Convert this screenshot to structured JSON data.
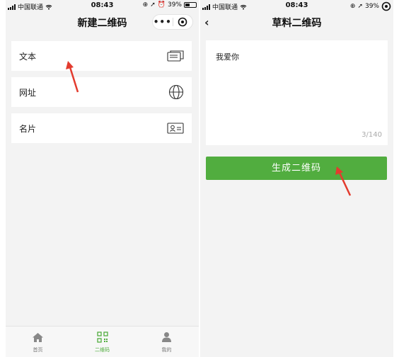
{
  "left": {
    "status": {
      "carrier": "中国联通",
      "time": "08:43",
      "battery": "39%"
    },
    "nav": {
      "title": "新建二维码",
      "more": "•••"
    },
    "items": [
      {
        "label": "文本",
        "icon": "text-card-icon"
      },
      {
        "label": "网址",
        "icon": "globe-icon"
      },
      {
        "label": "名片",
        "icon": "contact-card-icon"
      }
    ],
    "tabs": [
      {
        "label": "首页",
        "icon": "home-icon"
      },
      {
        "label": "二维码",
        "icon": "qr-code-icon",
        "active": true
      },
      {
        "label": "我的",
        "icon": "user-icon"
      }
    ]
  },
  "right": {
    "status": {
      "carrier": "中国联通",
      "time": "08:43",
      "battery": "39%"
    },
    "nav": {
      "title": "草料二维码",
      "back": "‹"
    },
    "textarea": {
      "value": "我爱你",
      "counter": "3/140"
    },
    "button": {
      "label": "生成二维码"
    }
  },
  "colors": {
    "accent": "#51ad3f",
    "arrow": "#e33b2e",
    "background": "#f3f3f3"
  }
}
